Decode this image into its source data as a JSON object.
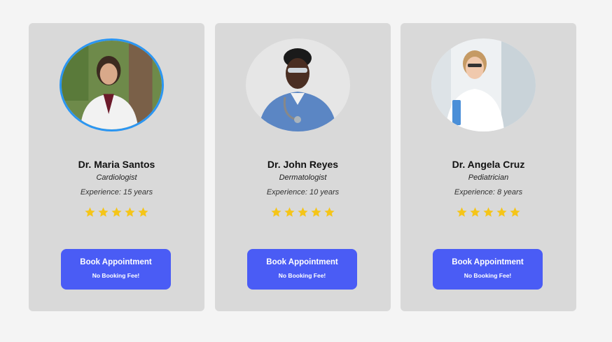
{
  "doctors": [
    {
      "name": "Dr. Maria Santos",
      "specialty": "Cardiologist",
      "experience": "Experience: 15 years",
      "rating": 5,
      "rating_max": 5,
      "avatar_icon": "doctor-portrait-female-outdoor",
      "highlighted": true,
      "button": {
        "label": "Book Appointment",
        "sublabel": "No Booking Fee!"
      }
    },
    {
      "name": "Dr. John Reyes",
      "specialty": "Dermatologist",
      "experience": "Experience: 10 years",
      "rating": 5,
      "rating_max": 5,
      "avatar_icon": "doctor-portrait-male-scrubs",
      "highlighted": false,
      "button": {
        "label": "Book Appointment",
        "sublabel": "No Booking Fee!"
      }
    },
    {
      "name": "Dr. Angela Cruz",
      "specialty": "Pediatrician",
      "experience": "Experience: 8 years",
      "rating": 5,
      "rating_max": 5,
      "avatar_icon": "doctor-portrait-female-clinic",
      "highlighted": false,
      "button": {
        "label": "Book Appointment",
        "sublabel": "No Booking Fee!"
      }
    }
  ],
  "colors": {
    "background": "#f4f4f4",
    "card": "#d9d9d9",
    "button": "#4a5cf5",
    "star": "#f5c518",
    "avatar_highlight_border": "#2b96f2"
  }
}
